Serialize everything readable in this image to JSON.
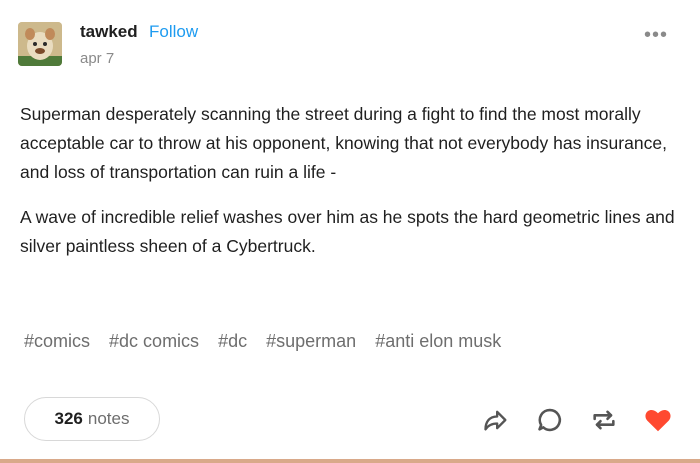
{
  "post": {
    "author": "tawked",
    "follow_label": "Follow",
    "date": "apr 7",
    "more_label": "•••",
    "paragraphs": [
      "Superman desperately scanning the street during a fight to find the most morally acceptable car to throw at his opponent, knowing that not everybody has insurance, and loss of transportation can ruin a life -",
      "A wave of incredible relief washes over him as he spots the hard geometric lines and silver paintless sheen of a Cybertruck."
    ],
    "tags": [
      "#comics",
      "#dc comics",
      "#dc",
      "#superman",
      "#anti elon musk"
    ],
    "notes_count": "326",
    "notes_label": "notes"
  },
  "icons": {
    "share": "share-icon",
    "reply": "reply-icon",
    "reblog": "reblog-icon",
    "like": "heart-icon"
  },
  "colors": {
    "accent_blue": "#1e9bf0",
    "like_red": "#ff4930",
    "muted_text": "#8a8a8a",
    "bottom_border": "#d9a98a"
  }
}
